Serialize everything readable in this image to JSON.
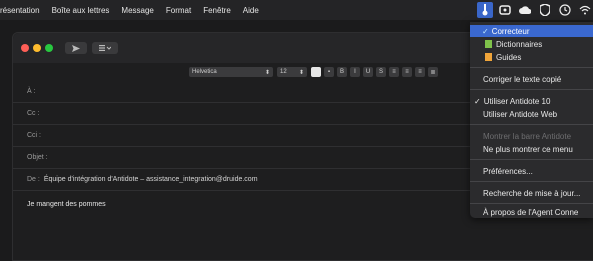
{
  "menubar": {
    "items": [
      "résentation",
      "Boîte aux lettres",
      "Message",
      "Format",
      "Fenêtre",
      "Aide"
    ],
    "status_icons": [
      "antidote-icon",
      "creative-cloud-icon",
      "cloud-icon",
      "shield-icon",
      "clock-icon",
      "wifi-icon"
    ]
  },
  "window": {
    "toolbar": {
      "send_icon": "send-icon",
      "header_icon": "header-icon"
    },
    "format": {
      "font": "Helvetica",
      "size": "12",
      "bold": "B",
      "italic": "I",
      "underline": "U",
      "strike": "S"
    },
    "fields": {
      "to_label": "À :",
      "cc_label": "Cc :",
      "bcc_label": "Cci :",
      "subject_label": "Objet :",
      "from_label": "De :",
      "from_value": "Équipe d'intégration d'Antidote – assistance_integration@druide.com"
    },
    "body": "Je mangent des pommes"
  },
  "dropdown": {
    "items": [
      {
        "label": "Correcteur",
        "icon": "checkmark-icon",
        "highlight": true
      },
      {
        "label": "Dictionnaires",
        "icon": "book-icon"
      },
      {
        "label": "Guides",
        "icon": "guide-icon"
      },
      {
        "label": "Corriger le texte copié"
      },
      {
        "label": "Utiliser Antidote 10",
        "checked": true
      },
      {
        "label": "Utiliser Antidote Web"
      },
      {
        "label": "Montrer la barre Antidote",
        "disabled": true
      },
      {
        "label": "Ne plus montrer ce menu"
      },
      {
        "label": "Préférences..."
      },
      {
        "label": "Recherche de mise à jour..."
      },
      {
        "label": "À propos de l'Agent Conne"
      }
    ],
    "colors": {
      "highlight": "#3a68cf",
      "dictionnaires": "#7fc24b",
      "guides": "#f0a53a"
    }
  }
}
